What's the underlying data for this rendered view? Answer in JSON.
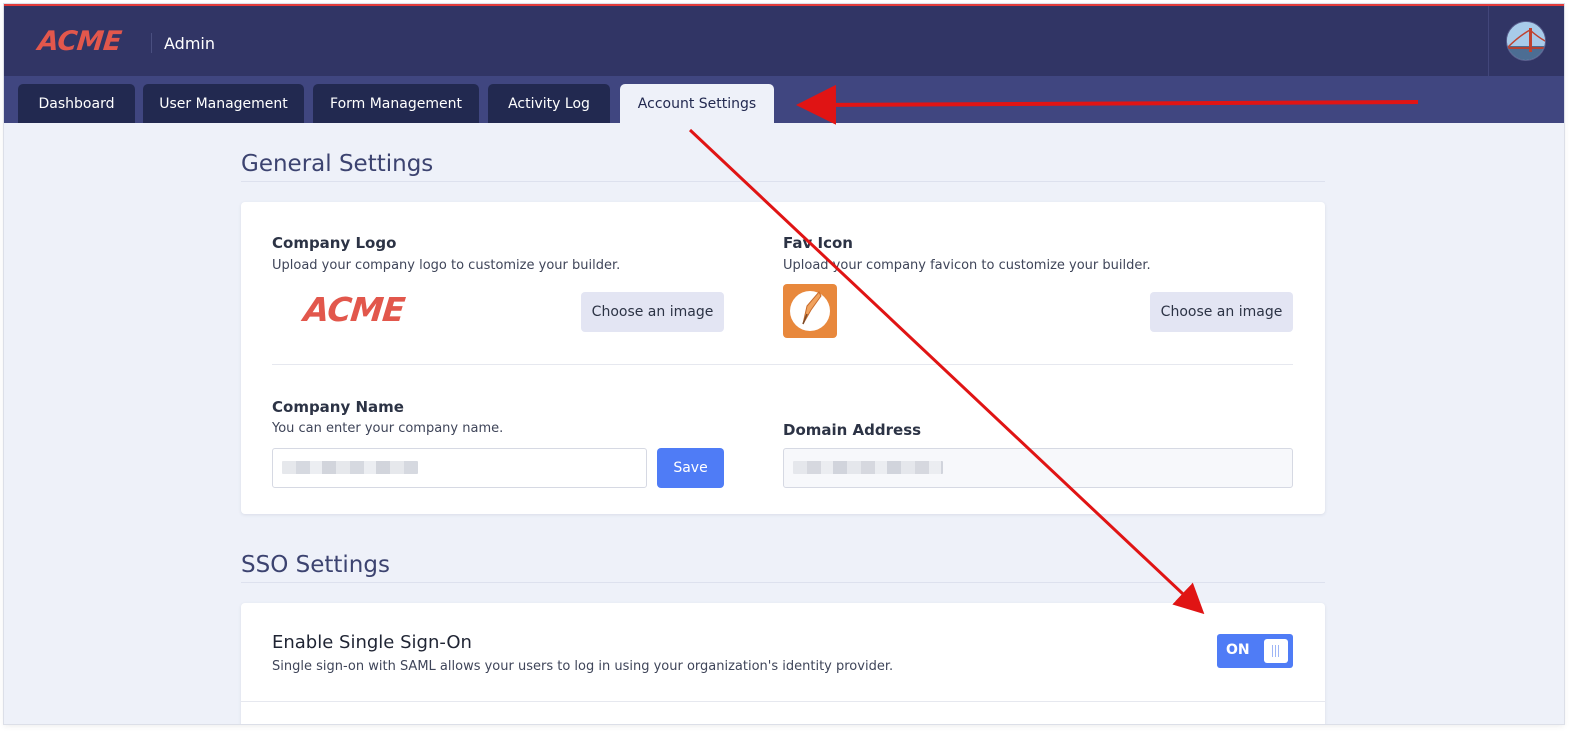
{
  "header": {
    "brand": "ACME",
    "title": "Admin"
  },
  "tabs": [
    {
      "label": "Dashboard"
    },
    {
      "label": "User Management"
    },
    {
      "label": "Form Management"
    },
    {
      "label": "Activity Log"
    },
    {
      "label": "Account Settings",
      "active": true
    }
  ],
  "general": {
    "title": "General Settings",
    "logo": {
      "label": "Company Logo",
      "description": "Upload your company logo to customize your builder.",
      "preview_text": "ACME",
      "button": "Choose an image"
    },
    "favicon": {
      "label": "Fav Icon",
      "description": "Upload your company favicon to customize your builder.",
      "button": "Choose an image"
    },
    "company_name": {
      "label": "Company Name",
      "description": "You can enter your company name.",
      "save_button": "Save"
    },
    "domain": {
      "label": "Domain Address"
    }
  },
  "sso": {
    "title": "SSO Settings",
    "enable": {
      "label": "Enable Single Sign-On",
      "description": "Single sign-on with SAML allows your users to log in using your organization's identity provider.",
      "toggle_label": "ON",
      "state": true
    }
  },
  "colors": {
    "header_bg": "#313565",
    "tab_bg": "#222950",
    "accent_blue": "#4f7cf6",
    "brand_red": "#e2574c",
    "annotation_red": "#e01414"
  },
  "icons": {
    "avatar": "avatar-photo-icon",
    "favicon": "pencil-app-icon"
  }
}
